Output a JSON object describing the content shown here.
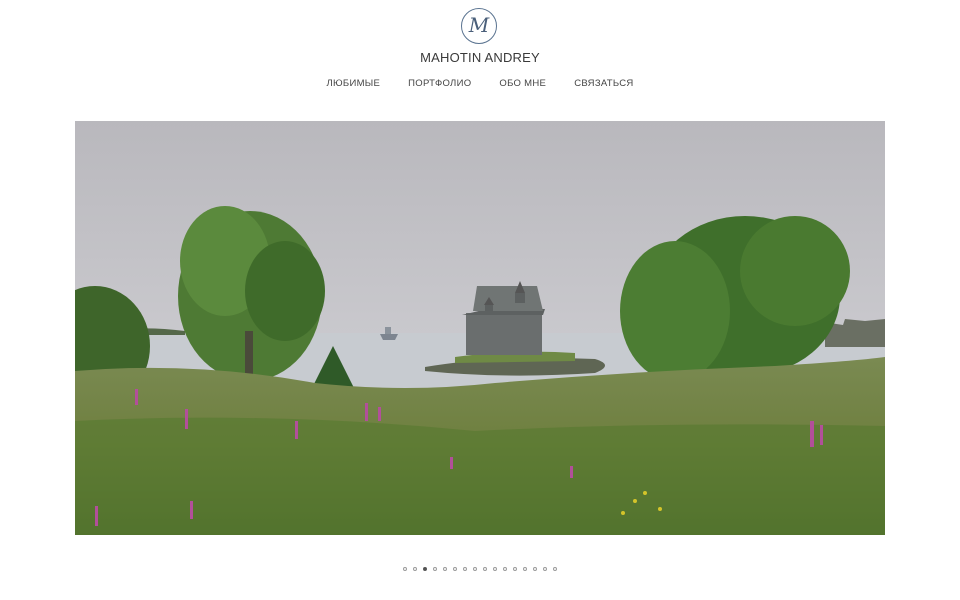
{
  "header": {
    "logo_monogram": "M",
    "site_title": "MAHOTIN ANDREY"
  },
  "nav": {
    "items": [
      {
        "label": "ЛЮБИМЫЕ"
      },
      {
        "label": "ПОРТФОЛИО"
      },
      {
        "label": "ОБО МНЕ"
      },
      {
        "label": "СВЯЗАТЬСЯ"
      }
    ]
  },
  "slideshow": {
    "image_name": "landscape-photo",
    "slide_count": 16,
    "active_index": 2
  },
  "colors": {
    "accent": "#5a7390",
    "dot_active": "#555555",
    "dot_inactive": "#9a9a9a"
  }
}
